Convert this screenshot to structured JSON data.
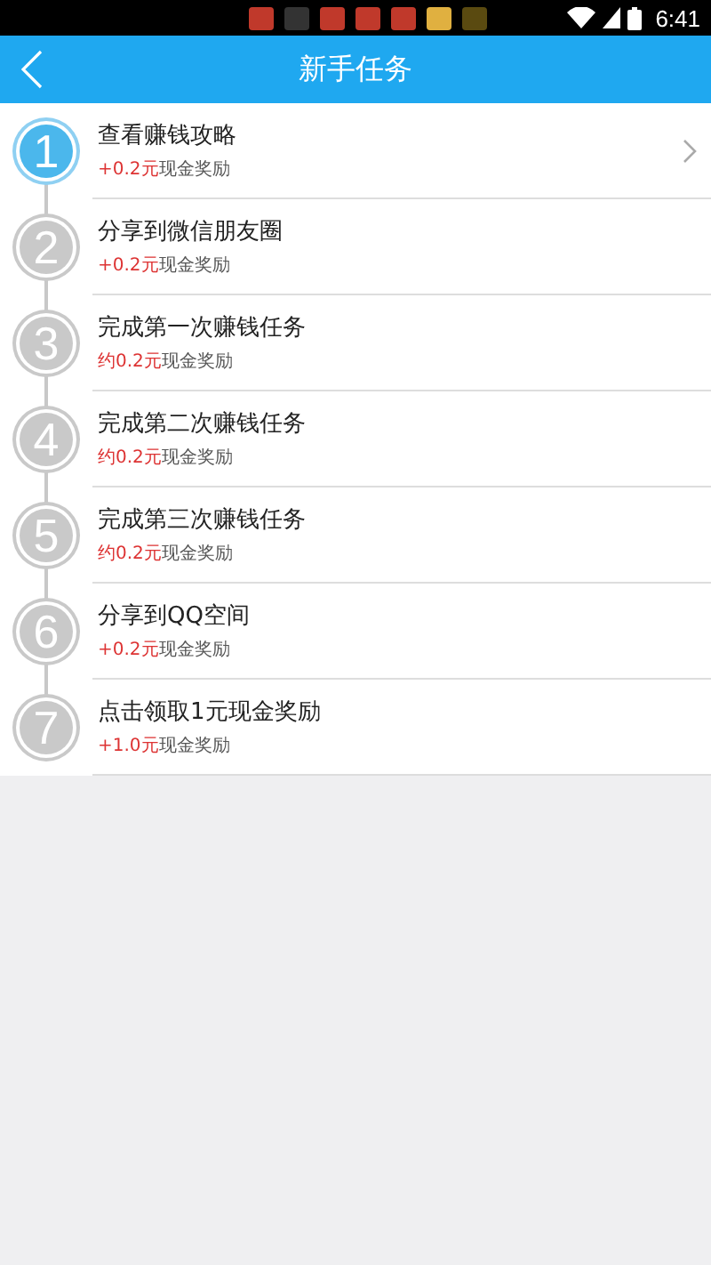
{
  "status_bar": {
    "time": "6:41"
  },
  "header": {
    "title": "新手任务"
  },
  "steps": [
    {
      "number": "1",
      "title": "查看赚钱攻略",
      "reward": "+0.2元",
      "reward_suffix": "现金奖励",
      "active": true
    },
    {
      "number": "2",
      "title": "分享到微信朋友圈",
      "reward": "+0.2元",
      "reward_suffix": "现金奖励",
      "active": false
    },
    {
      "number": "3",
      "title": "完成第一次赚钱任务",
      "reward": "约0.2元",
      "reward_suffix": "现金奖励",
      "active": false
    },
    {
      "number": "4",
      "title": "完成第二次赚钱任务",
      "reward": "约0.2元",
      "reward_suffix": "现金奖励",
      "active": false
    },
    {
      "number": "5",
      "title": "完成第三次赚钱任务",
      "reward": "约0.2元",
      "reward_suffix": "现金奖励",
      "active": false
    },
    {
      "number": "6",
      "title": "分享到QQ空间",
      "reward": "+0.2元",
      "reward_suffix": "现金奖励",
      "active": false
    },
    {
      "number": "7",
      "title": "点击领取1元现金奖励",
      "reward": "+1.0元",
      "reward_suffix": "现金奖励",
      "active": false
    }
  ]
}
